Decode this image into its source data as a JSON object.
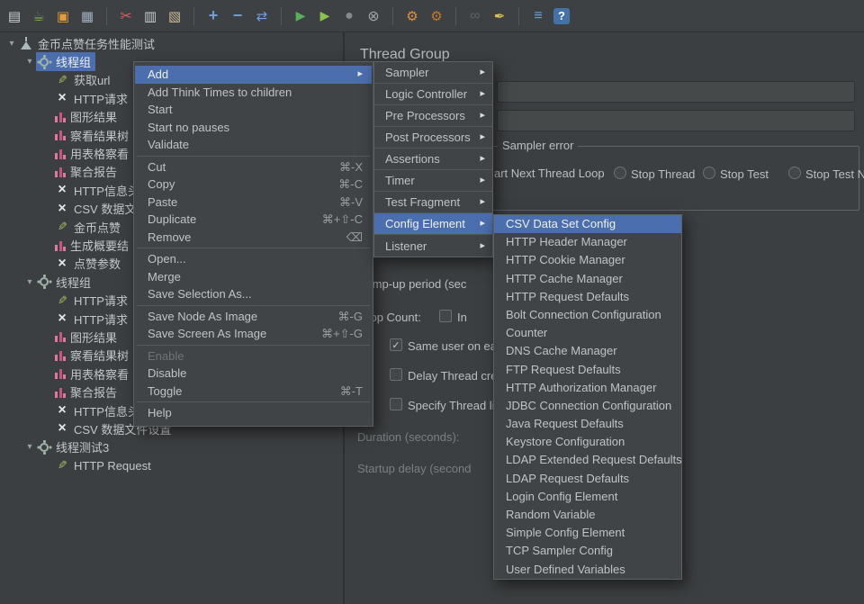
{
  "toolbar": {
    "buttons": [
      {
        "name": "new-file",
        "glyph": "▤"
      },
      {
        "name": "templates",
        "glyph": "☕"
      },
      {
        "name": "open-file",
        "glyph": "▣"
      },
      {
        "name": "save",
        "glyph": "▦"
      },
      {
        "name": "cut",
        "glyph": "✂"
      },
      {
        "name": "copy",
        "glyph": "▥"
      },
      {
        "name": "paste",
        "glyph": "▧"
      },
      {
        "name": "add",
        "glyph": "+"
      },
      {
        "name": "remove",
        "glyph": "−"
      },
      {
        "name": "toggle-edit",
        "glyph": "⇄"
      },
      {
        "name": "start",
        "glyph": "▶"
      },
      {
        "name": "start-no-pauses",
        "glyph": "▶"
      },
      {
        "name": "stop",
        "glyph": "●"
      },
      {
        "name": "shutdown",
        "glyph": "⊗"
      },
      {
        "name": "clear",
        "glyph": "⚙"
      },
      {
        "name": "clear-all",
        "glyph": "⚙"
      },
      {
        "name": "search",
        "glyph": "∞"
      },
      {
        "name": "search-reset",
        "glyph": "✒"
      },
      {
        "name": "function-helper",
        "glyph": "≡"
      },
      {
        "name": "help",
        "glyph": "?"
      }
    ]
  },
  "tree": {
    "items": [
      {
        "label": "金币点赞任务性能测试"
      },
      {
        "label": "线程组"
      },
      {
        "label": "获取url"
      },
      {
        "label": "HTTP请求"
      },
      {
        "label": "图形结果"
      },
      {
        "label": "察看结果树"
      },
      {
        "label": "用表格察看"
      },
      {
        "label": "聚合报告"
      },
      {
        "label": "HTTP信息头"
      },
      {
        "label": "CSV 数据文"
      },
      {
        "label": "金币点赞"
      },
      {
        "label": "生成概要结"
      },
      {
        "label": "点赞参数"
      },
      {
        "label": "线程组"
      },
      {
        "label": "HTTP请求"
      },
      {
        "label": "HTTP请求"
      },
      {
        "label": "图形结果"
      },
      {
        "label": "察看结果树"
      },
      {
        "label": "用表格察看"
      },
      {
        "label": "聚合报告"
      },
      {
        "label": "HTTP信息头管理器"
      },
      {
        "label": "CSV 数据文件设置"
      },
      {
        "label": "线程测试3"
      },
      {
        "label": "HTTP Request"
      }
    ]
  },
  "main": {
    "title": "Thread Group",
    "sampler_error_group_title": "Sampler error",
    "radio_options": [
      "art Next Thread Loop",
      "Stop Thread",
      "Stop Test",
      "Stop Test N"
    ],
    "ramp_up_label": "Ramp-up period (sec",
    "loop_count_label": "Loop Count:",
    "infinite_label": "In",
    "same_user_label": "Same user on ea",
    "same_user_check": "✓",
    "delay_thread_label": "Delay Thread cre",
    "specify_lifetime_label": "Specify Thread li",
    "duration_label": "Duration (seconds):",
    "startup_delay_label": "Startup delay (second"
  },
  "context_menu": {
    "items": [
      {
        "label": "Add",
        "submenu": true,
        "highlighted": true
      },
      {
        "label": "Add Think Times to children"
      },
      {
        "label": "Start"
      },
      {
        "label": "Start no pauses"
      },
      {
        "label": "Validate"
      },
      {
        "separator": true
      },
      {
        "label": "Cut",
        "shortcut": "⌘-X"
      },
      {
        "label": "Copy",
        "shortcut": "⌘-C"
      },
      {
        "label": "Paste",
        "shortcut": "⌘-V"
      },
      {
        "label": "Duplicate",
        "shortcut": "⌘+⇧-C"
      },
      {
        "label": "Remove",
        "shortcut": "⌫"
      },
      {
        "separator": true
      },
      {
        "label": "Open..."
      },
      {
        "label": "Merge"
      },
      {
        "label": "Save Selection As..."
      },
      {
        "separator": true
      },
      {
        "label": "Save Node As Image",
        "shortcut": "⌘-G"
      },
      {
        "label": "Save Screen As Image",
        "shortcut": "⌘+⇧-G"
      },
      {
        "separator": true
      },
      {
        "label": "Enable",
        "disabled": true
      },
      {
        "label": "Disable"
      },
      {
        "label": "Toggle",
        "shortcut": "⌘-T"
      },
      {
        "separator": true
      },
      {
        "label": "Help"
      }
    ]
  },
  "add_submenu": {
    "items": [
      {
        "label": "Sampler"
      },
      {
        "label": "Logic Controller"
      },
      {
        "label": "Pre Processors"
      },
      {
        "label": "Post Processors"
      },
      {
        "label": "Assertions"
      },
      {
        "label": "Timer"
      },
      {
        "label": "Test Fragment"
      },
      {
        "label": "Config Element",
        "highlighted": true
      },
      {
        "label": "Listener"
      }
    ]
  },
  "config_submenu": {
    "items": [
      {
        "label": "CSV Data Set Config",
        "highlighted": true
      },
      {
        "label": "HTTP Header Manager"
      },
      {
        "label": "HTTP Cookie Manager"
      },
      {
        "label": "HTTP Cache Manager"
      },
      {
        "label": "HTTP Request Defaults"
      },
      {
        "label": "Bolt Connection Configuration"
      },
      {
        "label": "Counter"
      },
      {
        "label": "DNS Cache Manager"
      },
      {
        "label": "FTP Request Defaults"
      },
      {
        "label": "HTTP Authorization Manager"
      },
      {
        "label": "JDBC Connection Configuration"
      },
      {
        "label": "Java Request Defaults"
      },
      {
        "label": "Keystore Configuration"
      },
      {
        "label": "LDAP Extended Request Defaults"
      },
      {
        "label": "LDAP Request Defaults"
      },
      {
        "label": "Login Config Element"
      },
      {
        "label": "Random Variable"
      },
      {
        "label": "Simple Config Element"
      },
      {
        "label": "TCP Sampler Config"
      },
      {
        "label": "User Defined Variables"
      }
    ]
  }
}
